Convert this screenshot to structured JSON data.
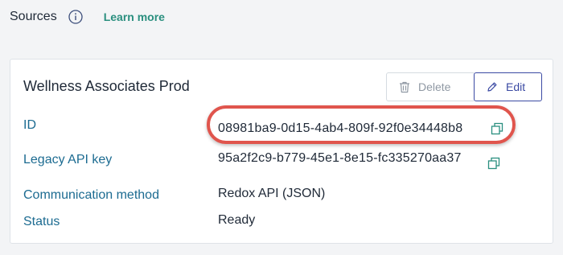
{
  "header": {
    "title": "Sources",
    "info_icon": "info-circle-icon",
    "learn_more": "Learn more"
  },
  "card": {
    "name": "Wellness Associates Prod",
    "buttons": {
      "delete": "Delete",
      "edit": "Edit"
    },
    "fields": [
      {
        "label": "ID",
        "value": "08981ba9-0d15-4ab4-809f-92f0e34448b8"
      },
      {
        "label": "Legacy API key",
        "value": "95a2f2c9-b779-45e1-8e15-fc335270aa37"
      },
      {
        "label": "Communication method",
        "value": "Redox API (JSON)"
      },
      {
        "label": "Status",
        "value": "Ready"
      }
    ]
  },
  "colors": {
    "accent_green": "#2a8f7f",
    "label_blue": "#1c6b91",
    "edit_blue": "#3b4aa3",
    "highlight_red": "#e0554d"
  }
}
